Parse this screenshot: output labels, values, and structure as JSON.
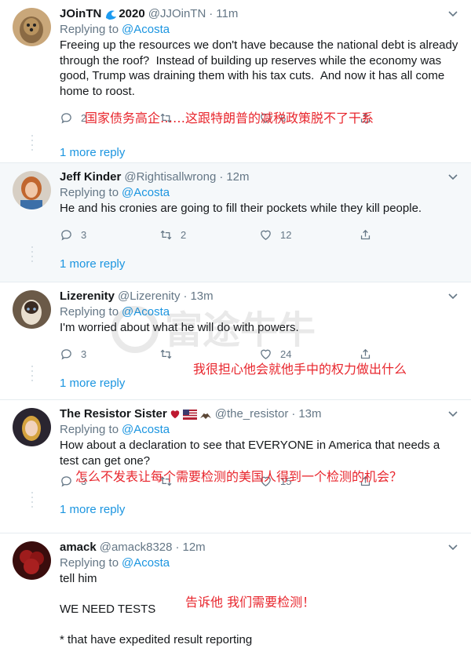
{
  "tweets": [
    {
      "name": "JOinTN",
      "name_suffix": "2020",
      "handle": "@JJOinTN",
      "time": "11m",
      "replying_label": "Replying to",
      "mention": "@Acosta",
      "body": "Freeing up the resources we don't have because the national debt is already through the roof?  Instead of building up reserves while the economy was good, Trump was draining them with his tax cuts.  And now it has all come home to roost.",
      "reply_count": "2",
      "retweet_count": "",
      "like_count": "6",
      "more_replies": "1 more reply",
      "translation": "国家债务高企……这跟特朗普的减税政策脱不了干系"
    },
    {
      "name": "Jeff Kinder",
      "handle": "@Rightisallwrong",
      "time": "12m",
      "replying_label": "Replying to",
      "mention": "@Acosta",
      "body": "He and his cronies are going to fill their pockets while they kill people.",
      "reply_count": "3",
      "retweet_count": "2",
      "like_count": "12",
      "more_replies": "1 more reply"
    },
    {
      "name": "Lizerenity",
      "handle": "@Lizerenity",
      "time": "13m",
      "replying_label": "Replying to",
      "mention": "@Acosta",
      "body": "I'm worried about what he will do with powers.",
      "reply_count": "3",
      "retweet_count": "",
      "like_count": "24",
      "more_replies": "1 more reply",
      "translation": "我很担心他会就他手中的权力做出什么"
    },
    {
      "name": "The Resistor Sister",
      "handle": "@the_resistor",
      "time": "13m",
      "replying_label": "Replying to",
      "mention": "@Acosta",
      "body": "How about a declaration to see that EVERYONE in America that needs a test can get one?",
      "reply_count": "3",
      "retweet_count": "",
      "like_count": "15",
      "more_replies": "1 more reply",
      "translation": "怎么不发表让每个需要检测的美国人得到一个检测的机会？"
    },
    {
      "name": "amack",
      "handle": "@amack8328",
      "time": "12m",
      "replying_label": "Replying to",
      "mention": "@Acosta",
      "body": "tell him\n\nWE NEED TESTS\n\n* that have expedited result reporting",
      "translation": "告诉他 我们需要检测！"
    }
  ],
  "watermark": "富途牛牛",
  "colors": {
    "link": "#1b95e0",
    "muted": "#657786",
    "annotation": "#e8262d"
  }
}
